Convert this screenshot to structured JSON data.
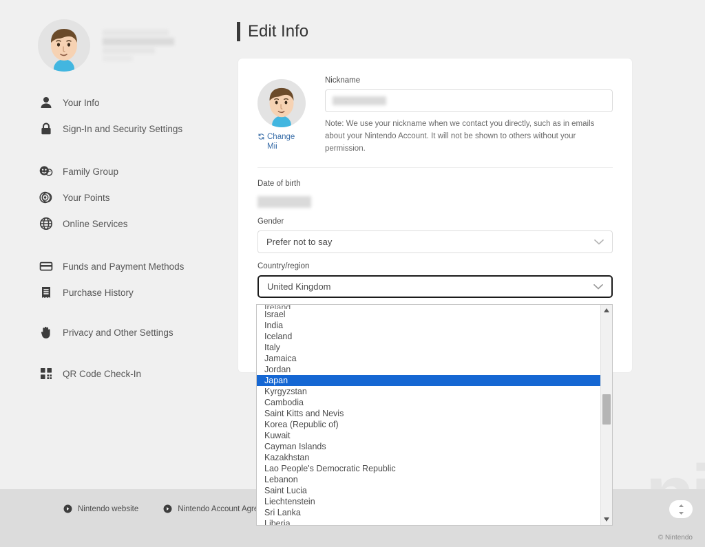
{
  "colors": {
    "page_bg": "#f0f0f0",
    "card_bg": "#ffffff",
    "footer_bg": "#dcdcdc",
    "highlight_blue": "#1567d3",
    "link_blue": "#3a6ea8",
    "text": "#4a4a4a"
  },
  "sidebar": {
    "profile": {
      "avatar_icon": "mii-avatar",
      "username_redacted": ""
    },
    "items": [
      {
        "label": "Your Info",
        "icon": "person-icon"
      },
      {
        "label": "Sign-In and Security Settings",
        "icon": "lock-icon"
      },
      {
        "label": "Family Group",
        "icon": "family-faces-icon"
      },
      {
        "label": "Your Points",
        "icon": "points-circles-icon"
      },
      {
        "label": "Online Services",
        "icon": "globe-icon"
      },
      {
        "label": "Funds and Payment Methods",
        "icon": "credit-card-icon"
      },
      {
        "label": "Purchase History",
        "icon": "receipt-icon"
      },
      {
        "label": "Privacy and Other Settings",
        "icon": "hand-icon"
      },
      {
        "label": "QR Code Check-In",
        "icon": "qr-code-icon"
      }
    ]
  },
  "main": {
    "page_title": "Edit Info",
    "mii": {
      "avatar_icon": "mii-avatar",
      "change_link": "Change Mii",
      "refresh_icon": "refresh-icon"
    },
    "nickname": {
      "label": "Nickname",
      "value": "",
      "placeholder": "",
      "note": "Note: We use your nickname when we contact you directly, such as in emails about your Nintendo Account. It will not be shown to others without your permission."
    },
    "date_of_birth": {
      "label": "Date of birth",
      "value_redacted": ""
    },
    "gender": {
      "label": "Gender",
      "selected": "Prefer not to say",
      "chevron_icon": "chevron-down-icon"
    },
    "country": {
      "label": "Country/region",
      "selected": "United Kingdom",
      "chevron_icon": "chevron-down-icon",
      "focused": true
    }
  },
  "dropdown": {
    "open": true,
    "clipped_top_option": "Ireland",
    "highlighted": "Japan",
    "options": [
      "Israel",
      "India",
      "Iceland",
      "Italy",
      "Jamaica",
      "Jordan",
      "Japan",
      "Kyrgyzstan",
      "Cambodia",
      "Saint Kitts and Nevis",
      "Korea (Republic of)",
      "Kuwait",
      "Cayman Islands",
      "Kazakhstan",
      "Lao People's Democratic Republic",
      "Lebanon",
      "Saint Lucia",
      "Liechtenstein",
      "Sri Lanka",
      "Liberia"
    ],
    "scrollbar": {
      "up_arrow_icon": "scroll-up-arrow-icon",
      "down_arrow_icon": "scroll-down-arrow-icon"
    }
  },
  "footer": {
    "links": [
      {
        "label": "Nintendo website",
        "icon": "arrow-circle-icon"
      },
      {
        "label": "Nintendo Account Agreement",
        "icon": "arrow-circle-icon"
      }
    ],
    "copyright": "© Nintendo",
    "scroll_toggle_icon": "scroll-updown-icon"
  },
  "watermark": {
    "text": "ni"
  }
}
